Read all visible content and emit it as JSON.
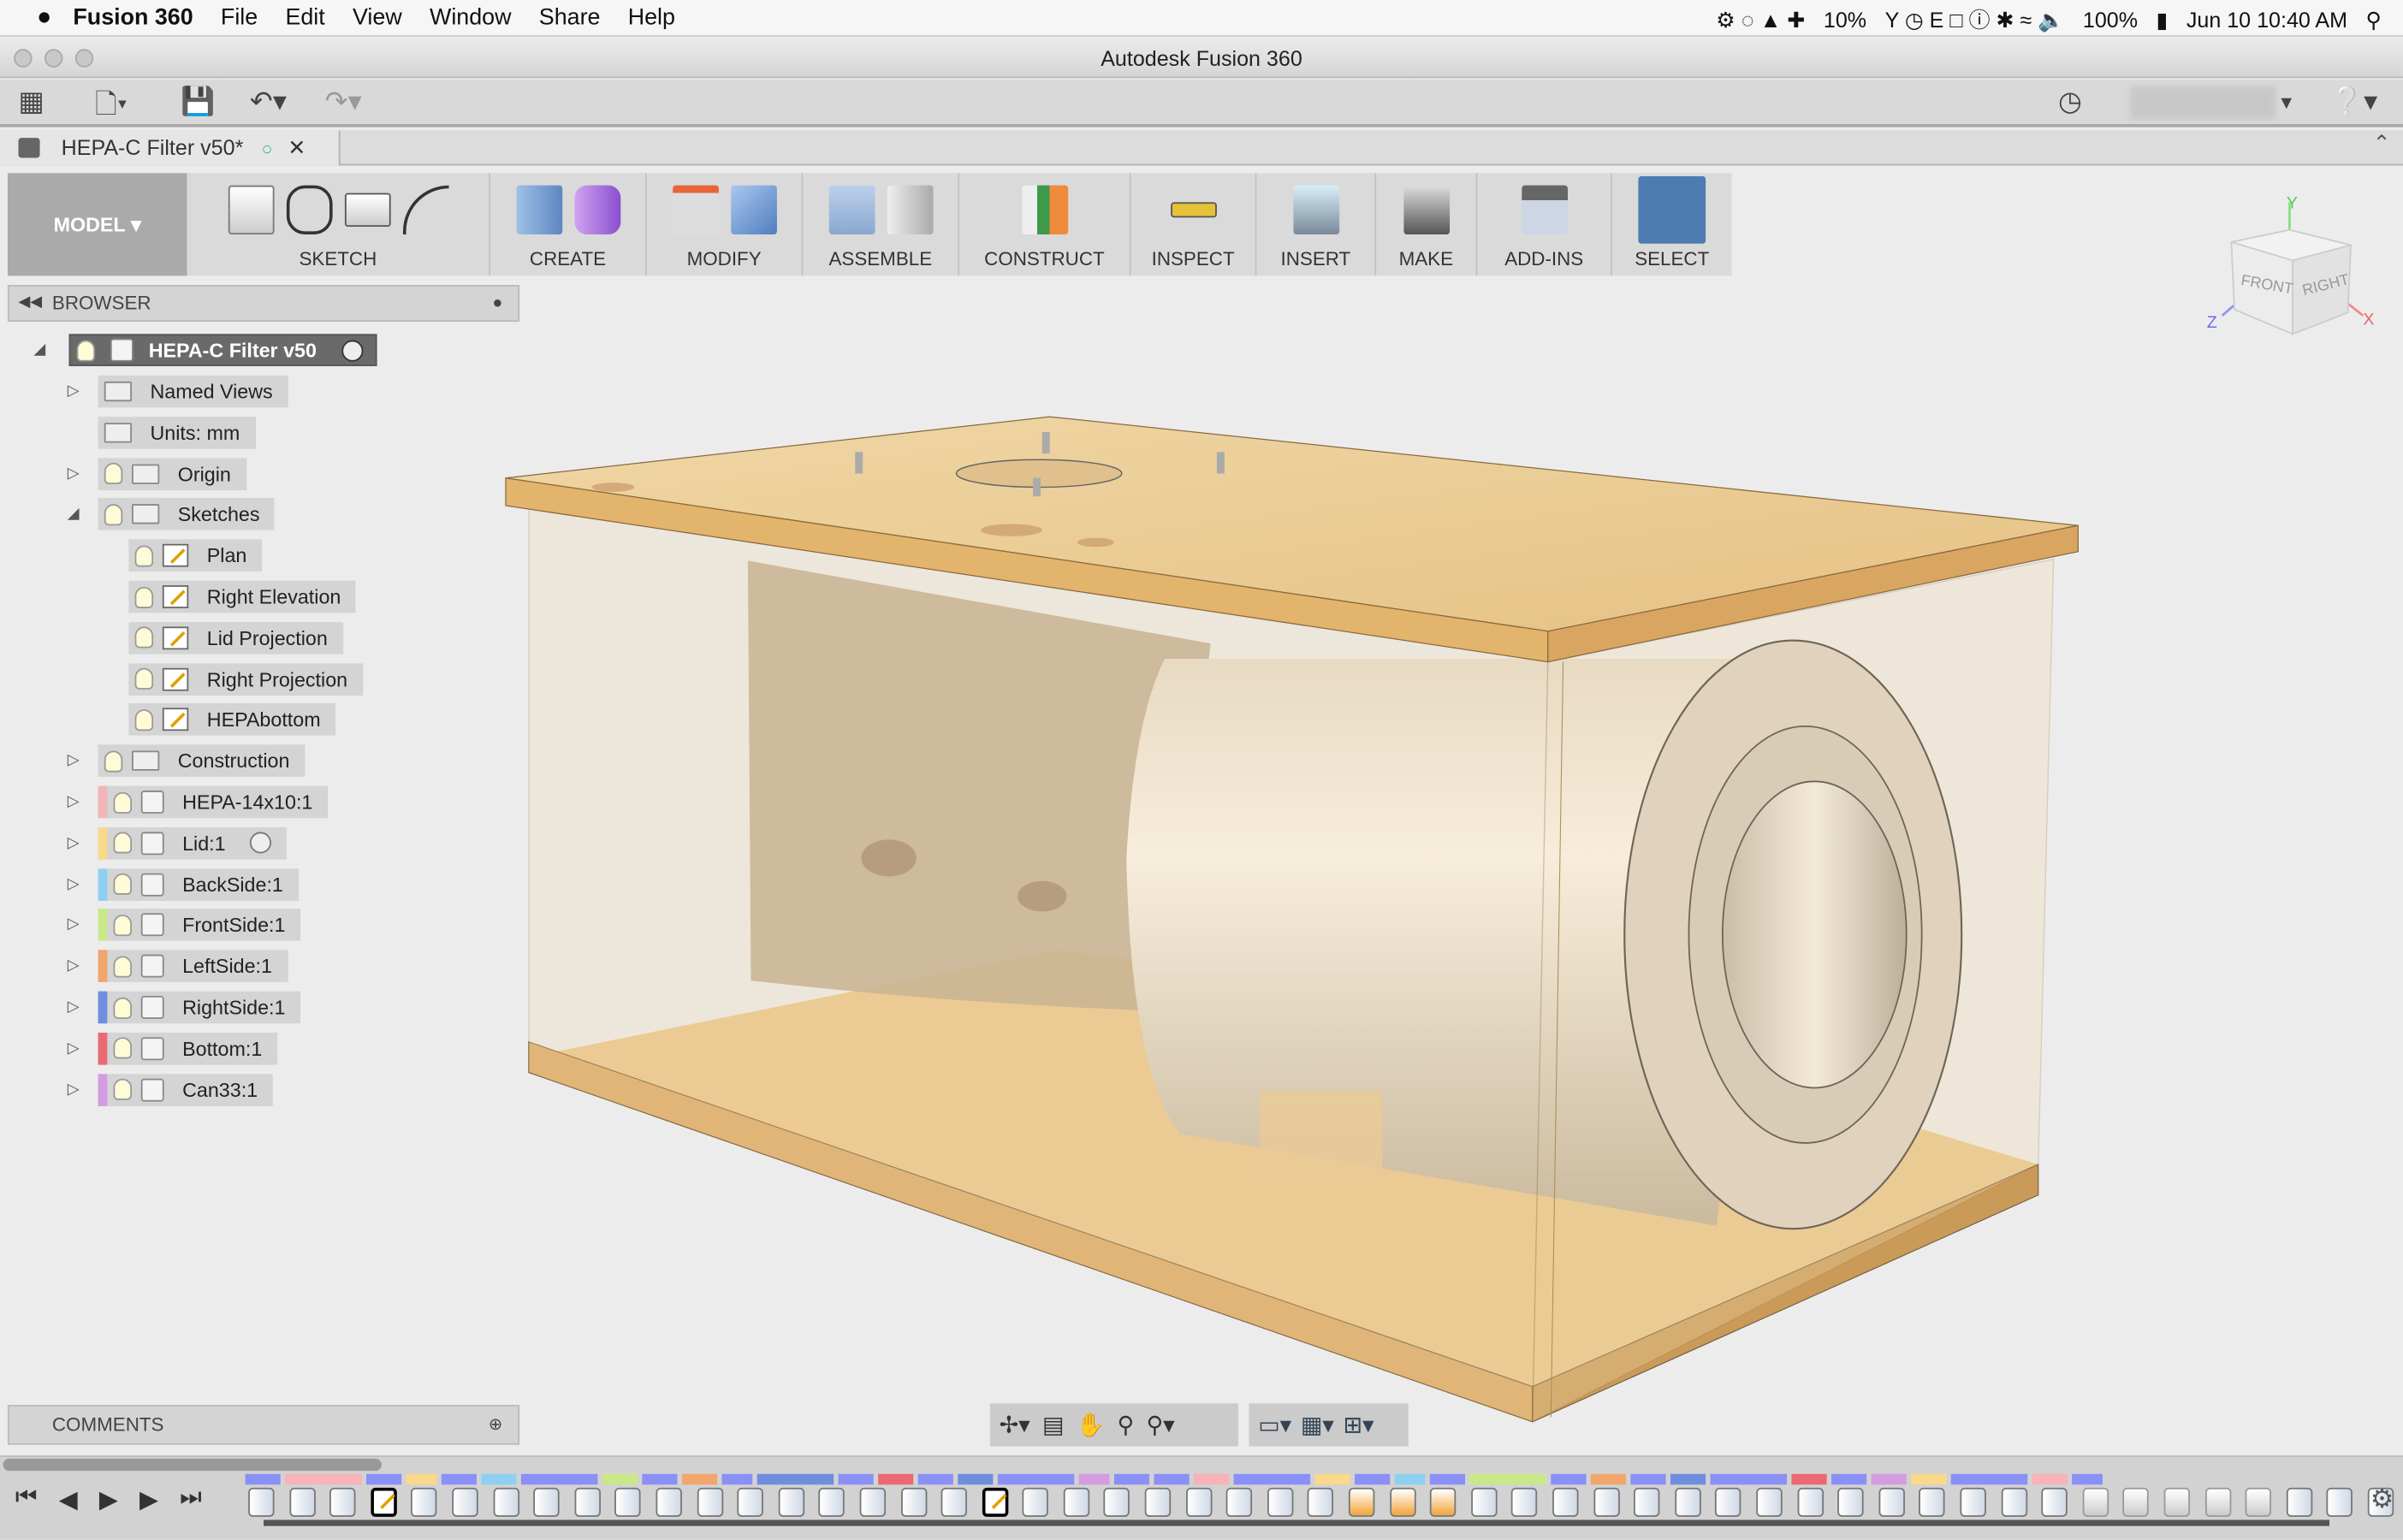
{
  "menubar": {
    "apple": "",
    "app": "Fusion 360",
    "items": [
      "File",
      "Edit",
      "View",
      "Window",
      "Share",
      "Help"
    ],
    "battery_cpu": "10%",
    "battery": "100%",
    "clock": "Jun 10  10:40 AM"
  },
  "window": {
    "title": "Autodesk Fusion 360"
  },
  "document_tab": {
    "label": "HEPA-C Filter v50*"
  },
  "ribbon": {
    "workspace": "MODEL",
    "groups": [
      "SKETCH",
      "CREATE",
      "MODIFY",
      "ASSEMBLE",
      "CONSTRUCT",
      "INSPECT",
      "INSERT",
      "MAKE",
      "ADD-INS",
      "SELECT"
    ]
  },
  "browser": {
    "title": "BROWSER",
    "root": "HEPA-C Filter v50",
    "items": [
      {
        "label": "Named Views",
        "level": 1,
        "expand": "collapsed",
        "icon": "folder"
      },
      {
        "label": "Units: mm",
        "level": 1,
        "expand": "none",
        "icon": "units"
      },
      {
        "label": "Origin",
        "level": 1,
        "expand": "collapsed",
        "icon": "folder",
        "bulb": true
      },
      {
        "label": "Sketches",
        "level": 1,
        "expand": "expanded",
        "icon": "folder",
        "bulb": true
      },
      {
        "label": "Plan",
        "level": 2,
        "expand": "none",
        "icon": "sketch",
        "bulb": true
      },
      {
        "label": "Right Elevation",
        "level": 2,
        "expand": "none",
        "icon": "sketch",
        "bulb": true
      },
      {
        "label": "Lid Projection",
        "level": 2,
        "expand": "none",
        "icon": "sketch",
        "bulb": true
      },
      {
        "label": "Right Projection",
        "level": 2,
        "expand": "none",
        "icon": "sketch",
        "bulb": true
      },
      {
        "label": "HEPAbottom",
        "level": 2,
        "expand": "none",
        "icon": "sketch",
        "bulb": true
      },
      {
        "label": "Construction",
        "level": 1,
        "expand": "collapsed",
        "icon": "folder",
        "bulb": true
      },
      {
        "label": "HEPA-14x10:1",
        "level": 1,
        "expand": "collapsed",
        "icon": "component",
        "bulb": true,
        "color": "#f4b5b8"
      },
      {
        "label": "Lid:1",
        "level": 1,
        "expand": "collapsed",
        "icon": "component",
        "bulb": true,
        "color": "#f9d98a",
        "radio": true
      },
      {
        "label": "BackSide:1",
        "level": 1,
        "expand": "collapsed",
        "icon": "component",
        "bulb": true,
        "color": "#8fd0f2"
      },
      {
        "label": "FrontSide:1",
        "level": 1,
        "expand": "collapsed",
        "icon": "component",
        "bulb": true,
        "color": "#c9e88a"
      },
      {
        "label": "LeftSide:1",
        "level": 1,
        "expand": "collapsed",
        "icon": "component",
        "bulb": true,
        "color": "#f2a56c"
      },
      {
        "label": "RightSide:1",
        "level": 1,
        "expand": "collapsed",
        "icon": "component",
        "bulb": true,
        "color": "#6f8ee0"
      },
      {
        "label": "Bottom:1",
        "level": 1,
        "expand": "collapsed",
        "icon": "component",
        "bulb": true,
        "color": "#ea6a72"
      },
      {
        "label": "Can33:1",
        "level": 1,
        "expand": "collapsed",
        "icon": "component",
        "bulb": true,
        "color": "#d59be0"
      }
    ]
  },
  "comments": {
    "title": "COMMENTS"
  },
  "viewcube": {
    "front": "FRONT",
    "right": "RIGHT",
    "x": "X",
    "y": "Y",
    "z": "Z"
  },
  "timeline": {
    "color_strip": [
      "#8a90f5",
      "#f7b3b8",
      "#8a90f5",
      "#f9d98a",
      "#8a90f5",
      "#8fd0f2",
      "#8a90f5",
      "#c9e88a",
      "#8a90f5",
      "#f2a56c",
      "#8a90f5",
      "#6f8ee0",
      "#8a90f5",
      "#ea6a72",
      "#8a90f5",
      "#6f8ee0",
      "#8a90f5",
      "#d59be0",
      "#8a90f5",
      "#8a90f5",
      "#f7b3b8",
      "#8a90f5",
      "#f9d98a",
      "#8a90f5",
      "#8fd0f2",
      "#8a90f5",
      "#c9e88a",
      "#8a90f5",
      "#f2a56c",
      "#8a90f5",
      "#6f8ee0",
      "#8a90f5",
      "#ea6a72",
      "#8a90f5",
      "#d59be0",
      "#f9d98a",
      "#8a90f5",
      "#f7b3b8",
      "#8a90f5"
    ],
    "features": [
      "body",
      "cyl",
      "cyl",
      "sketch",
      "body",
      "extrude",
      "body",
      "extrude",
      "body",
      "extrude",
      "body",
      "extrude",
      "body",
      "extrude",
      "body",
      "extrude",
      "body",
      "extrude",
      "sketch",
      "extrude",
      "body",
      "extrude",
      "cyl",
      "hole",
      "body",
      "extrude",
      "joint",
      "revolve",
      "revolve",
      "revolve",
      "mirror",
      "hole",
      "body",
      "extrude",
      "hole",
      "body",
      "extrude",
      "body",
      "extrude",
      "body",
      "extrude",
      "body",
      "extrude",
      "body",
      "extrude",
      "combine",
      "combine",
      "combine",
      "combine",
      "combine",
      "body",
      "extrude",
      "body"
    ]
  }
}
